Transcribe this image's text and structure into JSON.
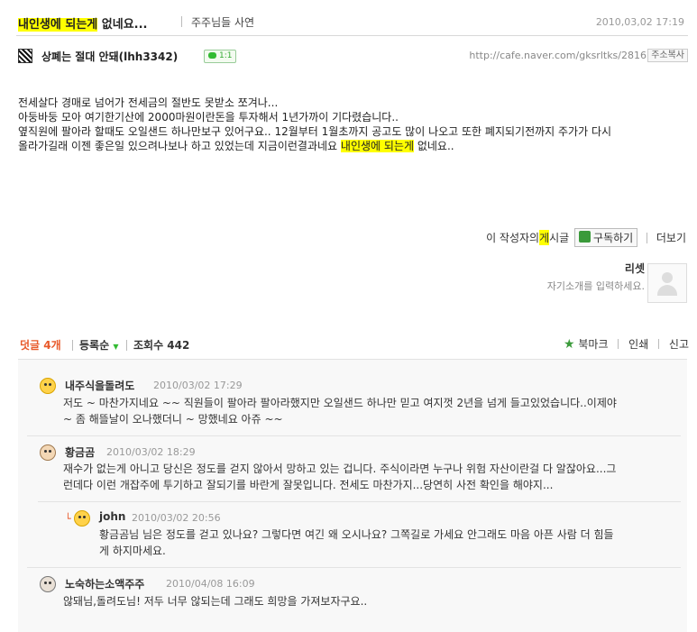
{
  "post": {
    "title_highlight": "내인생에 되는게",
    "title_rest": " 없네요...",
    "board": "주주님들 사연",
    "date": "2010,03,02 17:19",
    "author": "상폐는 절대 안돼(lhh3342)",
    "comment_badge": "1:1",
    "url": "http://cafe.naver.com/gksrltks/2816",
    "copy_url_label": "주소복사",
    "body": {
      "line1": "전세살다 경매로 넘어가 전세금의 절반도 못받소 쪼겨나...",
      "line2": "아둥바둥 모아 여기한기산에 2000마원이란돈을 투자해서 1년가까이 기다렸습니다..",
      "line3": "옆직원에 팔아라 할때도 오일샌드 하나만보구 있어구요.. 12월부터 1월초까지 공고도 많이 나오고 또한 폐지되기전까지 주가가 다시",
      "line4_pre": "올라가길래 이젠 좋은일 있으려나보나 하고 있었는데 지금이런결과네요 ",
      "line4_highlight": "내인생에 되는게",
      "line4_post": " 없네요.."
    }
  },
  "actions": {
    "author_posts_pre": "이 작성자의 ",
    "author_posts_highlight": "게",
    "author_posts_post": "시글",
    "subscribe_label": "구독하기",
    "more_label": "더보기"
  },
  "profile": {
    "name": "리셋",
    "intro": "자기소개를 입력하세요."
  },
  "comment_bar": {
    "count_label": "덧글 4개",
    "sort_label": "등록순",
    "view_count_label": "조회수 442",
    "bookmark_label": "북마크",
    "print_label": "인쇄",
    "report_label": "신고"
  },
  "comments": [
    {
      "name": "내주식을돌려도",
      "date": "2010/03/02 17:29",
      "line1": "저도 ~ 마찬가지네요 ~~ 직원들이 팔아라 팔아라했지만 오일샌드 하나만 믿고 여지껏 2년을 넘게 들고있었습니다..이제야",
      "line2": "~ 좀 해뜰날이 오나했더니 ~ 망했네요 아쥬 ~~"
    },
    {
      "name": "황금곰",
      "date": "2010/03/02 18:29",
      "line1": "재수가 없는게 아니고 당신은 정도를 걷지 않아서 망하고 있는 겁니다. 주식이라면 누구나 위험 자산이란걸 다 알잖아요...그",
      "line2": "런데다 이런 개잡주에 투기하고 잘되기를 바란게 잘못입니다. 전세도 마찬가지...당연히 사전 확인을 해야지..."
    },
    {
      "name": "john",
      "date": "2010/03/02 20:56",
      "line1": "황금곰님 님은 정도를 걷고 있나요? 그렇다면 여긴 왜 오시나요? 그쪽길로 가세요 안그래도 마음 아픈 사람 더 힘들",
      "line2": "게 하지마세요."
    },
    {
      "name": "노숙하는소액주주",
      "date": "2010/04/08 16:09",
      "line1": "않돼님,돌려도님! 저두 너무 않되는데 그래도 희망을 가져보자구요.."
    }
  ]
}
